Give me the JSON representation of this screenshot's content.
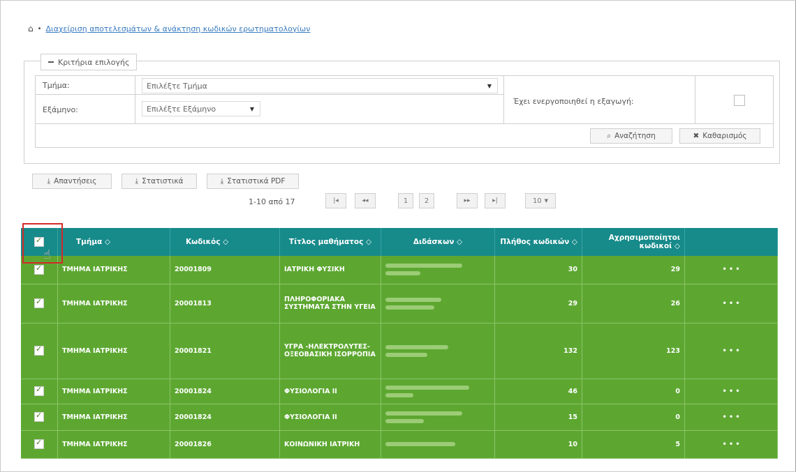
{
  "breadcrumb": {
    "home_icon": "home-icon",
    "link": "Διαχείριση αποτελεσμάτων & ανάκτηση κωδικών ερωτηματολογίων"
  },
  "criteria": {
    "legend": "Κριτήρια επιλογής",
    "department_label": "Τμήμα:",
    "department_value": "Επιλέξτε Τμήμα",
    "semester_label": "Εξάμηνο:",
    "semester_value": "Επιλέξτε Εξάμηνο",
    "export_label": "Έχει ενεργοποιηθεί η εξαγωγή:",
    "search_label": "Αναζήτηση",
    "clear_label": "Καθαρισμός"
  },
  "actions": {
    "answers": "Απαντήσεις",
    "stats": "Στατιστικά",
    "stats_pdf": "Στατιστικά PDF"
  },
  "pager": {
    "info": "1-10 από 17",
    "first": "|◂",
    "prev": "◂◂",
    "pages": [
      "1",
      "2"
    ],
    "next": "▸▸",
    "last": "▸|",
    "page_size": "10"
  },
  "table": {
    "headers": {
      "dept": "Τμήμα ◇",
      "code": "Κωδικός ◇",
      "title": "Τίτλος μαθήματος ◇",
      "teacher": "Διδάσκων ◇",
      "count": "Πλήθος κωδικών ◇",
      "unused": "Αχρησιμοποίητοι κωδικοί ◇"
    },
    "rows": [
      {
        "dept": "ΤΜΗΜΑ ΙΑΤΡΙΚΗΣ",
        "code": "20001809",
        "title": "ΙΑΤΡΙΚΗ ΦΥΣΙΚΗ",
        "count": "30",
        "unused": "29",
        "menu": "• • •"
      },
      {
        "dept": "ΤΜΗΜΑ ΙΑΤΡΙΚΗΣ",
        "code": "20001813",
        "title": "ΠΛΗΡΟΦΟΡΙΑΚΑ ΣΥΣΤΗΜΑΤΑ ΣΤΗΝ ΥΓΕΙΑ",
        "count": "29",
        "unused": "26",
        "menu": "• • •"
      },
      {
        "dept": "ΤΜΗΜΑ ΙΑΤΡΙΚΗΣ",
        "code": "20001821",
        "title": "ΥΓΡΑ -ΗΛΕΚΤΡΟΛΥΤΕΣ-ΟΞΕΟΒΑΣΙΚΗ ΙΣΟΡΡΟΠΙΑ",
        "count": "132",
        "unused": "123",
        "menu": "• • •"
      },
      {
        "dept": "ΤΜΗΜΑ ΙΑΤΡΙΚΗΣ",
        "code": "20001824",
        "title": "ΦΥΣΙΟΛΟΓΙΑ ΙΙ",
        "count": "46",
        "unused": "0",
        "menu": "• • •"
      },
      {
        "dept": "ΤΜΗΜΑ ΙΑΤΡΙΚΗΣ",
        "code": "20001824",
        "title": "ΦΥΣΙΟΛΟΓΙΑ ΙΙ",
        "count": "15",
        "unused": "0",
        "menu": "• • •"
      },
      {
        "dept": "ΤΜΗΜΑ ΙΑΤΡΙΚΗΣ",
        "code": "20001826",
        "title": "ΚΟΙΝΩΝΙΚΗ ΙΑΤΡΙΚΗ",
        "count": "10",
        "unused": "5",
        "menu": "• • •"
      }
    ]
  },
  "colors": {
    "header_teal": "#178a8a",
    "row_green": "#5da731",
    "highlight_red": "#d42a2a"
  }
}
